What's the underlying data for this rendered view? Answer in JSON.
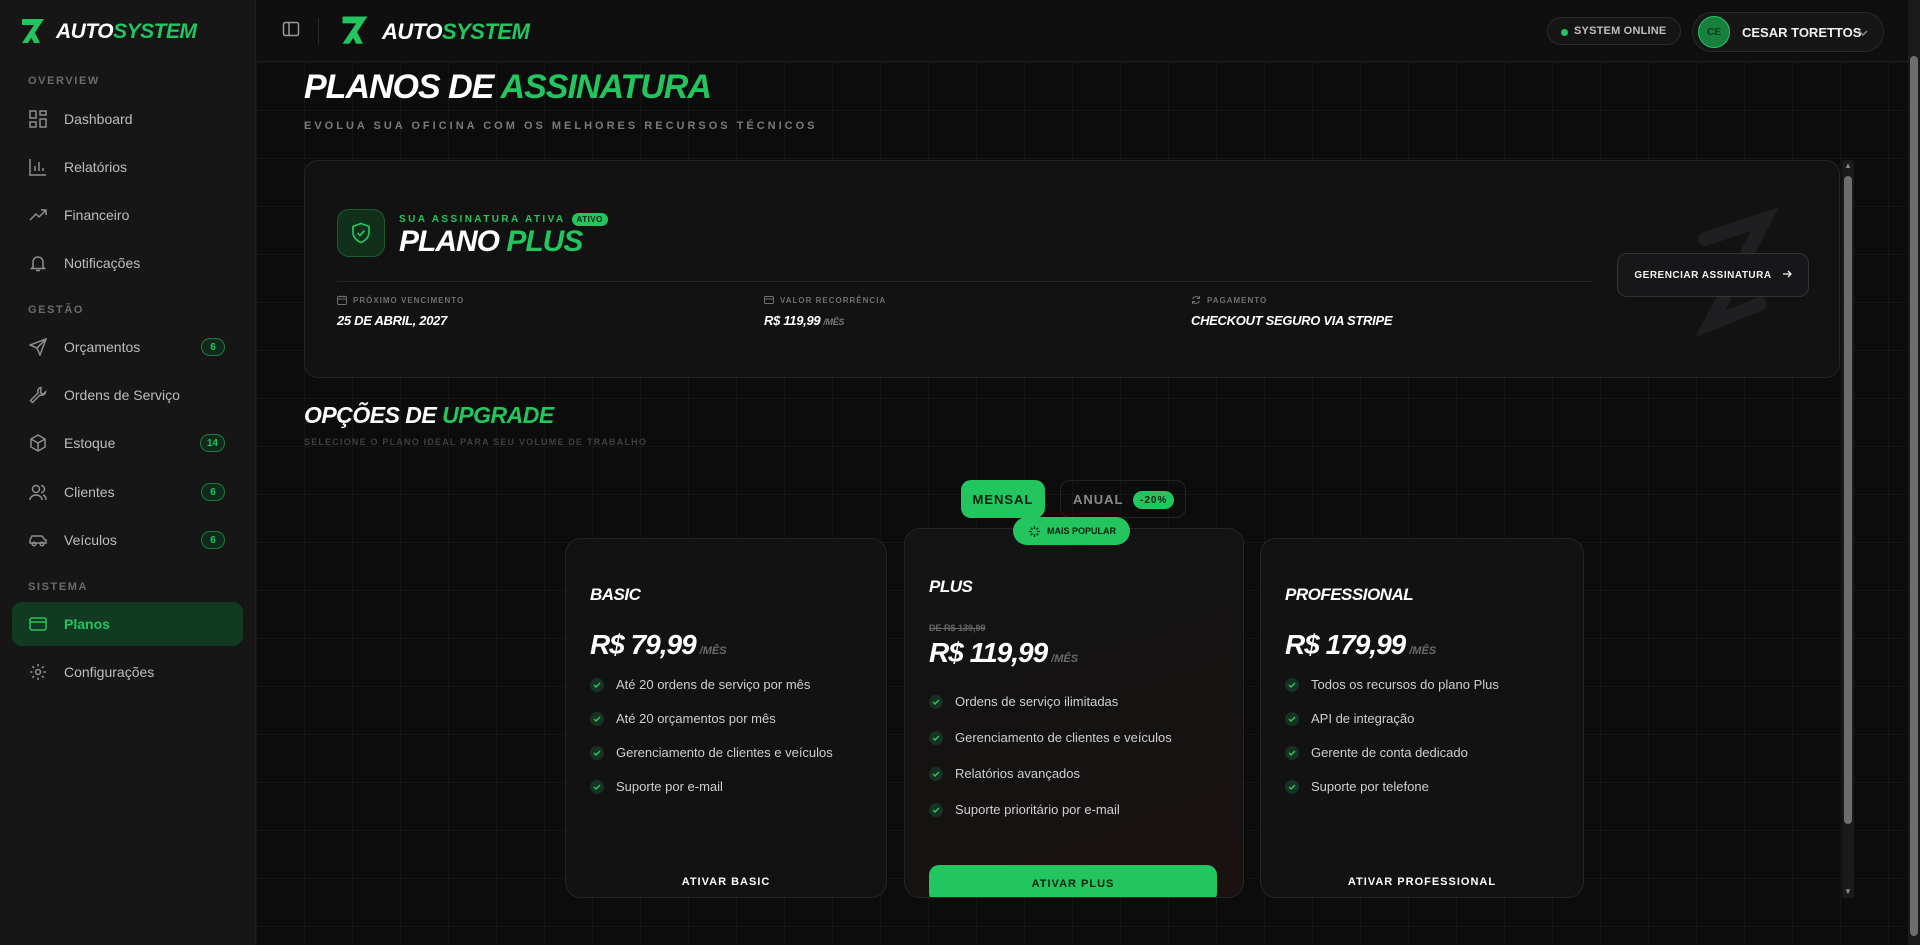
{
  "brand": {
    "part1": "AUTO",
    "part2": "SYSTEM"
  },
  "colors": {
    "accent": "#22c55e",
    "background": "#0c0c0d",
    "sidebar": "#161617"
  },
  "sidebar": {
    "sections": [
      {
        "label": "OVERVIEW"
      },
      {
        "label": "GESTÃO"
      },
      {
        "label": "SISTEMA"
      }
    ],
    "items": [
      {
        "label": "Dashboard",
        "icon": "grid-icon"
      },
      {
        "label": "Relatórios",
        "icon": "bar-chart-icon"
      },
      {
        "label": "Financeiro",
        "icon": "trending-up-icon"
      },
      {
        "label": "Notificações",
        "icon": "bell-icon"
      },
      {
        "label": "Orçamentos",
        "icon": "send-icon",
        "badge": "6"
      },
      {
        "label": "Ordens de Serviço",
        "icon": "wrench-icon"
      },
      {
        "label": "Estoque",
        "icon": "box-icon",
        "badge": "14"
      },
      {
        "label": "Clientes",
        "icon": "users-icon",
        "badge": "6"
      },
      {
        "label": "Veículos",
        "icon": "car-icon",
        "badge": "6"
      },
      {
        "label": "Planos",
        "icon": "credit-card-icon",
        "active": true
      },
      {
        "label": "Configurações",
        "icon": "gear-icon"
      }
    ]
  },
  "header": {
    "status": "SYSTEM ONLINE",
    "user_initials": "CE",
    "user_name": "CESAR TORETTOS"
  },
  "page": {
    "title_a": "PLANOS DE ",
    "title_b": "ASSINATURA",
    "subtitle": "EVOLUA SUA OFICINA COM OS MELHORES RECURSOS TÉCNICOS"
  },
  "subscription": {
    "kicker": "SUA ASSINATURA ATIVA",
    "status_tag": "ATIVO",
    "plan_a": "PLANO ",
    "plan_b": "PLUS",
    "next_due_label": "PRÓXIMO VENCIMENTO",
    "next_due_value": "25 DE ABRIL, 2027",
    "recurrence_label": "VALOR RECORRÊNCIA",
    "recurrence_value": "R$ 119,99",
    "recurrence_unit": "/MÊS",
    "payment_label": "PAGAMENTO",
    "payment_value": "CHECKOUT SEGURO VIA STRIPE",
    "manage_label": "GERENCIAR ASSINATURA"
  },
  "upgrade": {
    "title_a": "OPÇÕES DE ",
    "title_b": "UPGRADE",
    "subtitle": "SELECIONE O PLANO IDEAL PARA SEU VOLUME DE TRABALHO",
    "monthly_label": "MENSAL",
    "yearly_label": "ANUAL",
    "yearly_discount": "-20%",
    "popular_label": "MAIS POPULAR"
  },
  "plans": [
    {
      "name": "BASIC",
      "price": "R$ 79,99",
      "unit": "/MÊS",
      "features": [
        "Até 20 ordens de serviço por mês",
        "Até 20 orçamentos por mês",
        "Gerenciamento de clientes e veículos",
        "Suporte por e-mail"
      ],
      "cta": "ATIVAR BASIC"
    },
    {
      "name": "PLUS",
      "old_price": "DE R$ 139,99",
      "price": "R$ 119,99",
      "unit": "/MÊS",
      "features": [
        "Ordens de serviço ilimitadas",
        "Gerenciamento de clientes e veículos",
        "Relatórios avançados",
        "Suporte prioritário por e-mail"
      ],
      "cta": "ATIVAR PLUS"
    },
    {
      "name": "PROFESSIONAL",
      "price": "R$ 179,99",
      "unit": "/MÊS",
      "features": [
        "Todos os recursos do plano Plus",
        "API de integração",
        "Gerente de conta dedicado",
        "Suporte por telefone"
      ],
      "cta": "ATIVAR PROFESSIONAL"
    }
  ]
}
